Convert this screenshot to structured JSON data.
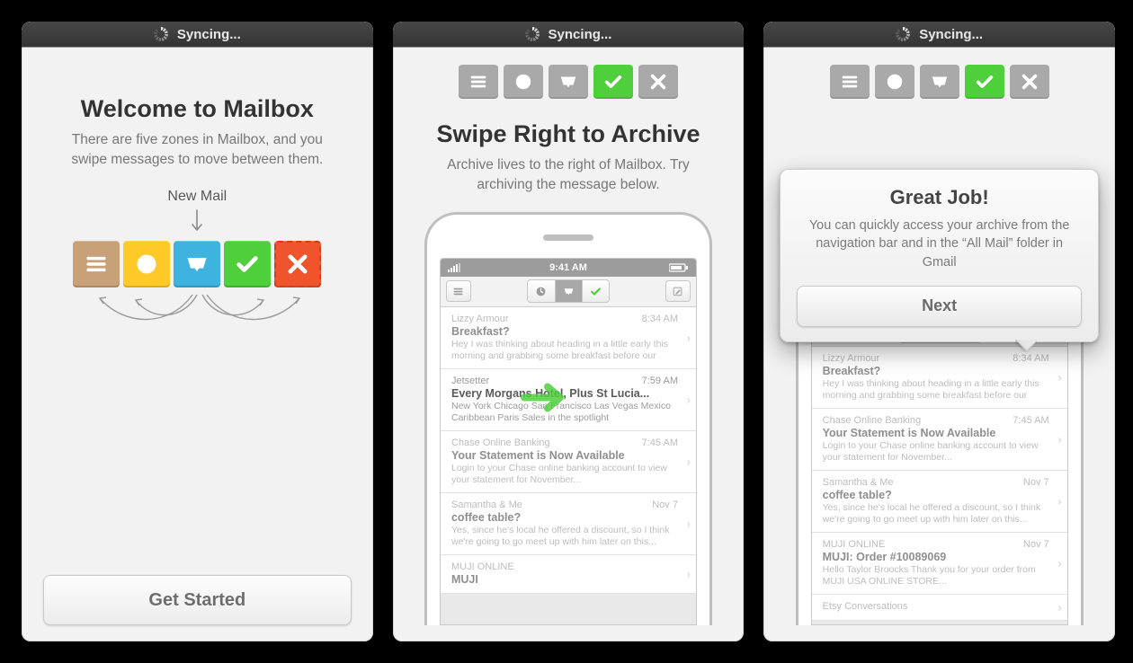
{
  "statusbar": {
    "label": "Syncing..."
  },
  "screen1": {
    "title": "Welcome to Mailbox",
    "subtitle": "There are five zones in Mailbox, and you swipe messages to move between them.",
    "new_mail_label": "New Mail",
    "cta": "Get Started",
    "zones": [
      "lists",
      "later",
      "inbox",
      "archive",
      "trash"
    ]
  },
  "screen2": {
    "title": "Swipe Right to Archive",
    "subtitle": "Archive lives to the right of Mailbox. Try archiving the message below.",
    "highlighted_email_index": 1
  },
  "screen3": {
    "popover": {
      "title": "Great Job!",
      "body": "You can quickly access your archive from the navigation bar and in the “All Mail” folder in Gmail",
      "cta": "Next"
    }
  },
  "phone": {
    "time": "9:41 AM",
    "emails_a": [
      {
        "from": "Lizzy Armour",
        "subject": "Breakfast?",
        "preview": "Hey I was thinking about heading in a little early this morning and grabbing some breakfast before our",
        "time": "8:34 AM"
      },
      {
        "from": "Jetsetter",
        "subject": "Every Morgans Hotel, Plus St Lucia...",
        "preview": "New York Chicago San Francisco Las Vegas Mexico Caribbean Paris Sales in the spotlight",
        "time": "7:59 AM"
      },
      {
        "from": "Chase Online Banking",
        "subject": "Your Statement is Now Available",
        "preview": "Login to your Chase online banking account to view your statement for November...",
        "time": "7:45 AM"
      },
      {
        "from": "Samantha & Me",
        "subject": "coffee table?",
        "preview": "Yes, since he's local he offered a discount, so I think we're going to go meet up with him later on this...",
        "time": "Nov 7"
      },
      {
        "from": "MUJI ONLINE",
        "subject": "MUJI",
        "preview": "",
        "time": ""
      }
    ],
    "emails_b": [
      {
        "from": "Lizzy Armour",
        "subject": "Breakfast?",
        "preview": "Hey I was thinking about heading in a little early this morning and grabbing some breakfast before our",
        "time": "8:34 AM"
      },
      {
        "from": "Chase Online Banking",
        "subject": "Your Statement is Now Available",
        "preview": "Login to your Chase online banking account to view your statement for November...",
        "time": "7:45 AM"
      },
      {
        "from": "Samantha & Me",
        "subject": "coffee table?",
        "preview": "Yes, since he's local he offered a discount, so I think we're going to go meet up with him later on this...",
        "time": "Nov 7"
      },
      {
        "from": "MUJI ONLINE",
        "subject": "MUJI: Order #10089069",
        "preview": "Hello Taylor Broocks Thank you for your order from MUJI USA ONLINE STORE...",
        "time": "Nov 7"
      },
      {
        "from": "Etsy Conversations",
        "subject": "",
        "preview": "",
        "time": ""
      }
    ]
  },
  "colors": {
    "tan": "#c9a178",
    "yellow": "#ffc928",
    "blue": "#3eb3e0",
    "green": "#4ecf3b",
    "orange": "#f0542c",
    "tile_gray": "#a9a9a9"
  }
}
